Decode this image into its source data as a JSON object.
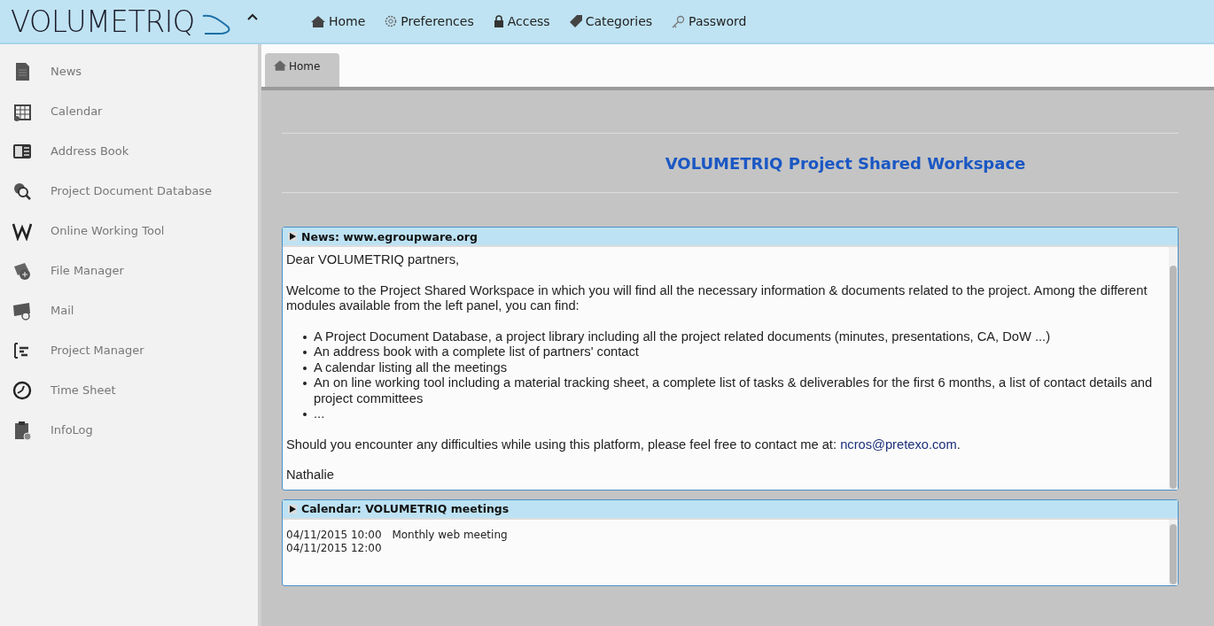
{
  "header": {
    "logo": "VOLUMETRIQ",
    "nav": [
      {
        "label": "Home"
      },
      {
        "label": "Preferences"
      },
      {
        "label": "Access"
      },
      {
        "label": "Categories"
      },
      {
        "label": "Password"
      }
    ]
  },
  "sidebar": {
    "items": [
      {
        "label": "News"
      },
      {
        "label": "Calendar"
      },
      {
        "label": "Address Book"
      },
      {
        "label": "Project Document Database"
      },
      {
        "label": "Online Working Tool"
      },
      {
        "label": "File Manager"
      },
      {
        "label": "Mail"
      },
      {
        "label": "Project Manager"
      },
      {
        "label": "Time Sheet"
      },
      {
        "label": "InfoLog"
      }
    ]
  },
  "tabs": [
    {
      "label": "Home",
      "selected": true
    }
  ],
  "page_title": "VOLUMETRIQ Project Shared Workspace",
  "news": {
    "title": "News: www.egroupware.org",
    "greeting": "Dear VOLUMETRIQ partners,",
    "intro": "Welcome to the Project Shared Workspace in which you will find all the necessary information & documents related to the project. Among the different modules available from the left panel, you can find:",
    "bullets": [
      "A Project Document Database, a project library including all the project related documents (minutes, presentations, CA, DoW ...)",
      "An address book with a complete list of partners' contact",
      "A calendar listing all the meetings",
      "An on line working tool including a material tracking sheet, a complete list of tasks & deliverables for the first 6 months, a list of contact details and project committees",
      "..."
    ],
    "contact_text": "Should you encounter any difficulties while using this platform, please feel free to contact me at:",
    "contact_email": "ncros@pretexo.com",
    "contact_end": ".",
    "signature": "Nathalie"
  },
  "calendar": {
    "title": "Calendar: VOLUMETRIQ meetings",
    "events": [
      {
        "time": "04/11/2015 10:00",
        "title": "Monthly web meeting"
      },
      {
        "time": "04/11/2015 12:00"
      }
    ]
  }
}
